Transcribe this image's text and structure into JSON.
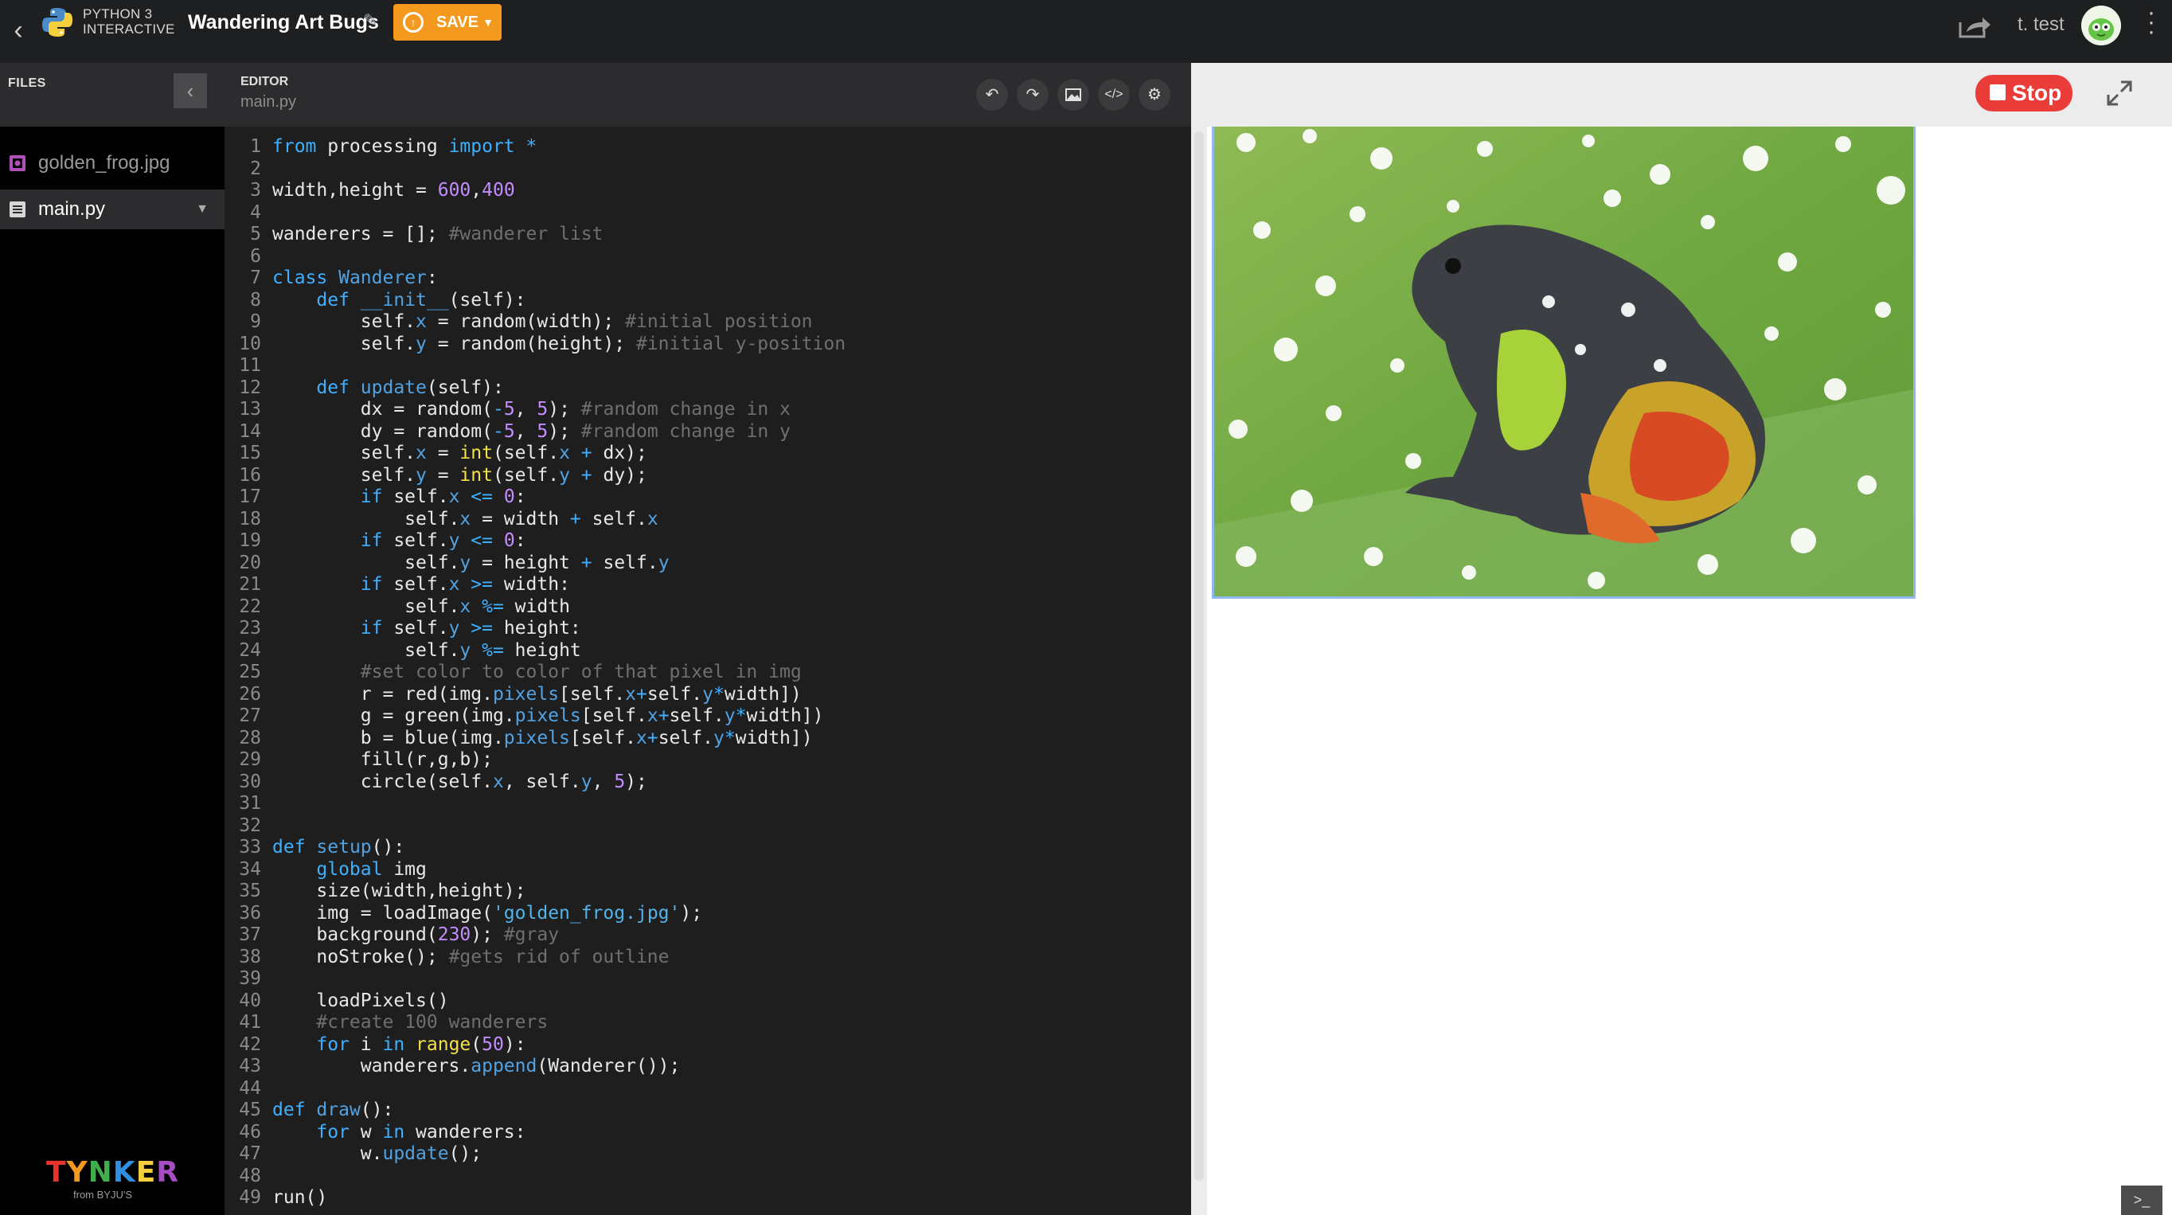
{
  "topbar": {
    "back_icon": "chevron-left-icon",
    "language_line1": "PYTHON 3",
    "language_line2": "INTERACTIVE",
    "project_title": "Wandering Art Bugs",
    "save_label": "SAVE",
    "username": "t. test",
    "accent_color": "#f39a1e"
  },
  "files": {
    "title": "FILES",
    "items": [
      {
        "name": "golden_frog.jpg",
        "icon": "image-file-icon",
        "active": false
      },
      {
        "name": "main.py",
        "icon": "text-file-icon",
        "active": true
      }
    ]
  },
  "brand": {
    "name": "TYNKER",
    "sub": "from BYJU'S"
  },
  "editor": {
    "title": "EDITOR",
    "filename": "main.py",
    "tools": [
      "undo-icon",
      "redo-icon",
      "image-icon",
      "code-icon",
      "gear-icon"
    ]
  },
  "code_lines": [
    [
      [
        "k",
        "from"
      ],
      [
        "t",
        " processing "
      ],
      [
        "k",
        "import"
      ],
      [
        "t",
        " "
      ],
      [
        "k",
        "*"
      ]
    ],
    [],
    [
      [
        "t",
        "width,height = "
      ],
      [
        "n",
        "600"
      ],
      [
        "t",
        ","
      ],
      [
        "n",
        "400"
      ]
    ],
    [],
    [
      [
        "t",
        "wanderers = []; "
      ],
      [
        "c",
        "#wanderer list"
      ]
    ],
    [],
    [
      [
        "k",
        "class"
      ],
      [
        "t",
        " "
      ],
      [
        "a",
        "Wanderer"
      ],
      [
        "t",
        ":"
      ]
    ],
    [
      [
        "t",
        "    "
      ],
      [
        "k",
        "def"
      ],
      [
        "t",
        " "
      ],
      [
        "a",
        "__init__"
      ],
      [
        "t",
        "(self):"
      ]
    ],
    [
      [
        "t",
        "        self."
      ],
      [
        "a",
        "x"
      ],
      [
        "t",
        " = random(width); "
      ],
      [
        "c",
        "#initial position"
      ]
    ],
    [
      [
        "t",
        "        self."
      ],
      [
        "a",
        "y"
      ],
      [
        "t",
        " = random(height); "
      ],
      [
        "c",
        "#initial y-position"
      ]
    ],
    [],
    [
      [
        "t",
        "    "
      ],
      [
        "k",
        "def"
      ],
      [
        "t",
        " "
      ],
      [
        "a",
        "update"
      ],
      [
        "t",
        "(self):"
      ]
    ],
    [
      [
        "t",
        "        dx = random("
      ],
      [
        "k",
        "-"
      ],
      [
        "n",
        "5"
      ],
      [
        "t",
        ", "
      ],
      [
        "n",
        "5"
      ],
      [
        "t",
        "); "
      ],
      [
        "c",
        "#random change in x"
      ]
    ],
    [
      [
        "t",
        "        dy = random("
      ],
      [
        "k",
        "-"
      ],
      [
        "n",
        "5"
      ],
      [
        "t",
        ", "
      ],
      [
        "n",
        "5"
      ],
      [
        "t",
        "); "
      ],
      [
        "c",
        "#random change in y"
      ]
    ],
    [
      [
        "t",
        "        self."
      ],
      [
        "a",
        "x"
      ],
      [
        "t",
        " = "
      ],
      [
        "f",
        "int"
      ],
      [
        "t",
        "(self."
      ],
      [
        "a",
        "x"
      ],
      [
        "t",
        " "
      ],
      [
        "k",
        "+"
      ],
      [
        "t",
        " dx);"
      ]
    ],
    [
      [
        "t",
        "        self."
      ],
      [
        "a",
        "y"
      ],
      [
        "t",
        " = "
      ],
      [
        "f",
        "int"
      ],
      [
        "t",
        "(self."
      ],
      [
        "a",
        "y"
      ],
      [
        "t",
        " "
      ],
      [
        "k",
        "+"
      ],
      [
        "t",
        " dy);"
      ]
    ],
    [
      [
        "t",
        "        "
      ],
      [
        "k",
        "if"
      ],
      [
        "t",
        " self."
      ],
      [
        "a",
        "x"
      ],
      [
        "t",
        " "
      ],
      [
        "k",
        "<="
      ],
      [
        "t",
        " "
      ],
      [
        "n",
        "0"
      ],
      [
        "t",
        ":"
      ]
    ],
    [
      [
        "t",
        "            self."
      ],
      [
        "a",
        "x"
      ],
      [
        "t",
        " = width "
      ],
      [
        "k",
        "+"
      ],
      [
        "t",
        " self."
      ],
      [
        "a",
        "x"
      ]
    ],
    [
      [
        "t",
        "        "
      ],
      [
        "k",
        "if"
      ],
      [
        "t",
        " self."
      ],
      [
        "a",
        "y"
      ],
      [
        "t",
        " "
      ],
      [
        "k",
        "<="
      ],
      [
        "t",
        " "
      ],
      [
        "n",
        "0"
      ],
      [
        "t",
        ":"
      ]
    ],
    [
      [
        "t",
        "            self."
      ],
      [
        "a",
        "y"
      ],
      [
        "t",
        " = height "
      ],
      [
        "k",
        "+"
      ],
      [
        "t",
        " self."
      ],
      [
        "a",
        "y"
      ]
    ],
    [
      [
        "t",
        "        "
      ],
      [
        "k",
        "if"
      ],
      [
        "t",
        " self."
      ],
      [
        "a",
        "x"
      ],
      [
        "t",
        " "
      ],
      [
        "k",
        ">="
      ],
      [
        "t",
        " width:"
      ]
    ],
    [
      [
        "t",
        "            self."
      ],
      [
        "a",
        "x"
      ],
      [
        "t",
        " "
      ],
      [
        "k",
        "%="
      ],
      [
        "t",
        " width"
      ]
    ],
    [
      [
        "t",
        "        "
      ],
      [
        "k",
        "if"
      ],
      [
        "t",
        " self."
      ],
      [
        "a",
        "y"
      ],
      [
        "t",
        " "
      ],
      [
        "k",
        ">="
      ],
      [
        "t",
        " height:"
      ]
    ],
    [
      [
        "t",
        "            self."
      ],
      [
        "a",
        "y"
      ],
      [
        "t",
        " "
      ],
      [
        "k",
        "%="
      ],
      [
        "t",
        " height"
      ]
    ],
    [
      [
        "t",
        "        "
      ],
      [
        "c",
        "#set color to color of that pixel in img"
      ]
    ],
    [
      [
        "t",
        "        r = red(img."
      ],
      [
        "a",
        "pixels"
      ],
      [
        "t",
        "[self."
      ],
      [
        "a",
        "x"
      ],
      [
        "k",
        "+"
      ],
      [
        "t",
        "self."
      ],
      [
        "a",
        "y"
      ],
      [
        "k",
        "*"
      ],
      [
        "t",
        "width])"
      ]
    ],
    [
      [
        "t",
        "        g = green(img."
      ],
      [
        "a",
        "pixels"
      ],
      [
        "t",
        "[self."
      ],
      [
        "a",
        "x"
      ],
      [
        "k",
        "+"
      ],
      [
        "t",
        "self."
      ],
      [
        "a",
        "y"
      ],
      [
        "k",
        "*"
      ],
      [
        "t",
        "width])"
      ]
    ],
    [
      [
        "t",
        "        b = blue(img."
      ],
      [
        "a",
        "pixels"
      ],
      [
        "t",
        "[self."
      ],
      [
        "a",
        "x"
      ],
      [
        "k",
        "+"
      ],
      [
        "t",
        "self."
      ],
      [
        "a",
        "y"
      ],
      [
        "k",
        "*"
      ],
      [
        "t",
        "width])"
      ]
    ],
    [
      [
        "t",
        "        fill(r,g,b);"
      ]
    ],
    [
      [
        "t",
        "        circle(self."
      ],
      [
        "a",
        "x"
      ],
      [
        "t",
        ", self."
      ],
      [
        "a",
        "y"
      ],
      [
        "t",
        ", "
      ],
      [
        "n",
        "5"
      ],
      [
        "t",
        ");"
      ]
    ],
    [],
    [],
    [
      [
        "k",
        "def"
      ],
      [
        "t",
        " "
      ],
      [
        "a",
        "setup"
      ],
      [
        "t",
        "():"
      ]
    ],
    [
      [
        "t",
        "    "
      ],
      [
        "k",
        "global"
      ],
      [
        "t",
        " img"
      ]
    ],
    [
      [
        "t",
        "    size(width,height);"
      ]
    ],
    [
      [
        "t",
        "    img = loadImage("
      ],
      [
        "s",
        "'golden_frog.jpg'"
      ],
      [
        "t",
        ");"
      ]
    ],
    [
      [
        "t",
        "    background("
      ],
      [
        "n",
        "230"
      ],
      [
        "t",
        "); "
      ],
      [
        "c",
        "#gray"
      ]
    ],
    [
      [
        "t",
        "    noStroke(); "
      ],
      [
        "c",
        "#gets rid of outline"
      ]
    ],
    [],
    [
      [
        "t",
        "    loadPixels()"
      ]
    ],
    [
      [
        "t",
        "    "
      ],
      [
        "c",
        "#create 100 wanderers"
      ]
    ],
    [
      [
        "t",
        "    "
      ],
      [
        "k",
        "for"
      ],
      [
        "t",
        " i "
      ],
      [
        "k",
        "in"
      ],
      [
        "t",
        " "
      ],
      [
        "f",
        "range"
      ],
      [
        "t",
        "("
      ],
      [
        "n",
        "50"
      ],
      [
        "t",
        "):"
      ]
    ],
    [
      [
        "t",
        "        wanderers."
      ],
      [
        "a",
        "append"
      ],
      [
        "t",
        "(Wanderer());"
      ]
    ],
    [],
    [
      [
        "k",
        "def"
      ],
      [
        "t",
        " "
      ],
      [
        "a",
        "draw"
      ],
      [
        "t",
        "():"
      ]
    ],
    [
      [
        "t",
        "    "
      ],
      [
        "k",
        "for"
      ],
      [
        "t",
        " w "
      ],
      [
        "k",
        "in"
      ],
      [
        "t",
        " wanderers:"
      ]
    ],
    [
      [
        "t",
        "        w."
      ],
      [
        "a",
        "update"
      ],
      [
        "t",
        "();"
      ]
    ],
    [],
    [
      [
        "t",
        "run()"
      ]
    ]
  ],
  "preview": {
    "stop_label": "Stop",
    "stop_color": "#ea3d3a",
    "fullscreen_icon": "expand-icon",
    "console_icon": "terminal-icon"
  }
}
